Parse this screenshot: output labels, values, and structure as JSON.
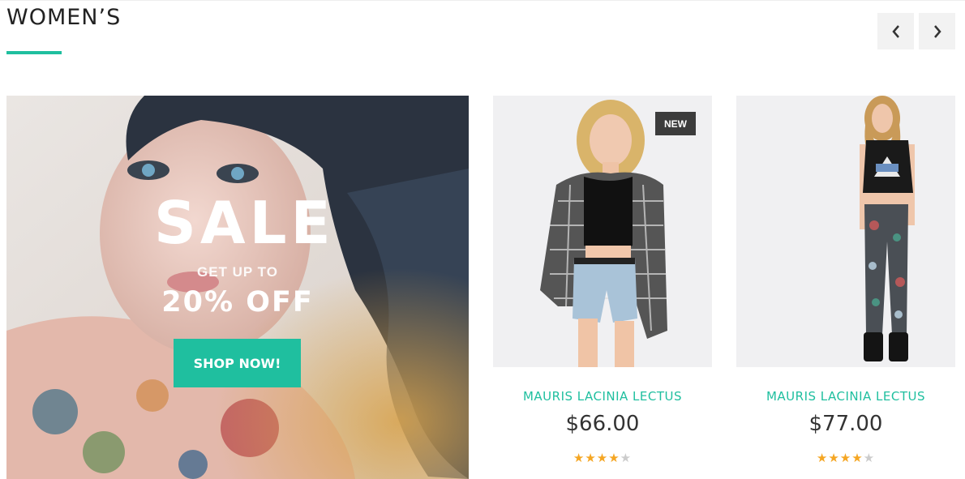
{
  "section": {
    "title": "WOMEN’S"
  },
  "navigation": {
    "prev_icon": "chevron-left-icon",
    "next_icon": "chevron-right-icon"
  },
  "banner": {
    "headline": "SALE",
    "subline": "GET UP TO",
    "discount": "20% OFF",
    "button_label": "SHOP NOW!"
  },
  "products": [
    {
      "name": "MAURIS LACINIA LECTUS",
      "price": "$66.00",
      "badge": "NEW",
      "rating": 4,
      "rating_max": 5
    },
    {
      "name": "MAURIS LACINIA LECTUS",
      "price": "$77.00",
      "badge": "",
      "rating": 4,
      "rating_max": 5
    }
  ],
  "colors": {
    "accent": "#1fbf9f",
    "star": "#f5a623",
    "badge_bg": "#3c3c3c"
  }
}
